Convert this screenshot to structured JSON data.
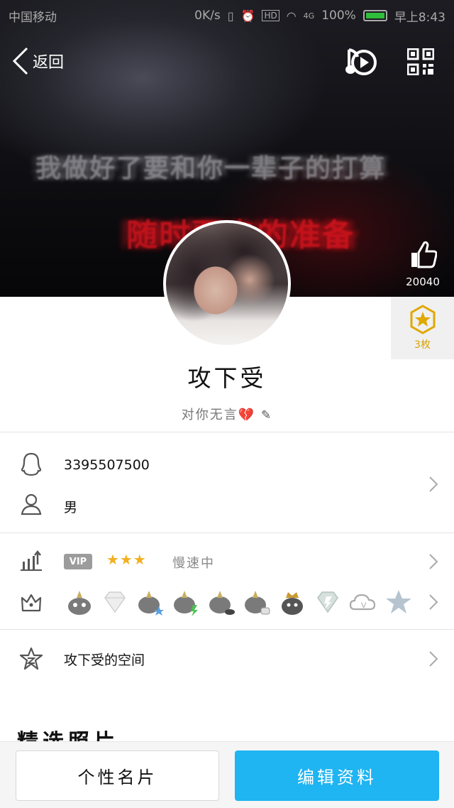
{
  "statusbar": {
    "carrier": "中国移动",
    "speed": "0K/s",
    "hd": "HD",
    "signal": "4G",
    "battery": "100%",
    "time": "早上8:43"
  },
  "header": {
    "back_label": "返回",
    "cover_caption": "我做好了要和你一辈子的打算",
    "cover_caption2": "随时要走的准备",
    "like_count": "20040",
    "badge_count": "3枚"
  },
  "profile": {
    "nickname": "攻下受",
    "signature": "对你无言",
    "signature_emoji": "💔"
  },
  "info": {
    "qq_number": "3395507500",
    "gender": "男"
  },
  "level": {
    "vip_tag": "VIP",
    "crowns": "★★★",
    "speed_status": "慢速中"
  },
  "space": {
    "label": "攻下受的空间"
  },
  "featured": {
    "title": "精选照片"
  },
  "buttons": {
    "card": "个性名片",
    "edit": "编辑资料"
  },
  "colors": {
    "accent": "#1fb4f2",
    "badge_gold": "#d8a100",
    "cover_red": "#e0141e"
  }
}
